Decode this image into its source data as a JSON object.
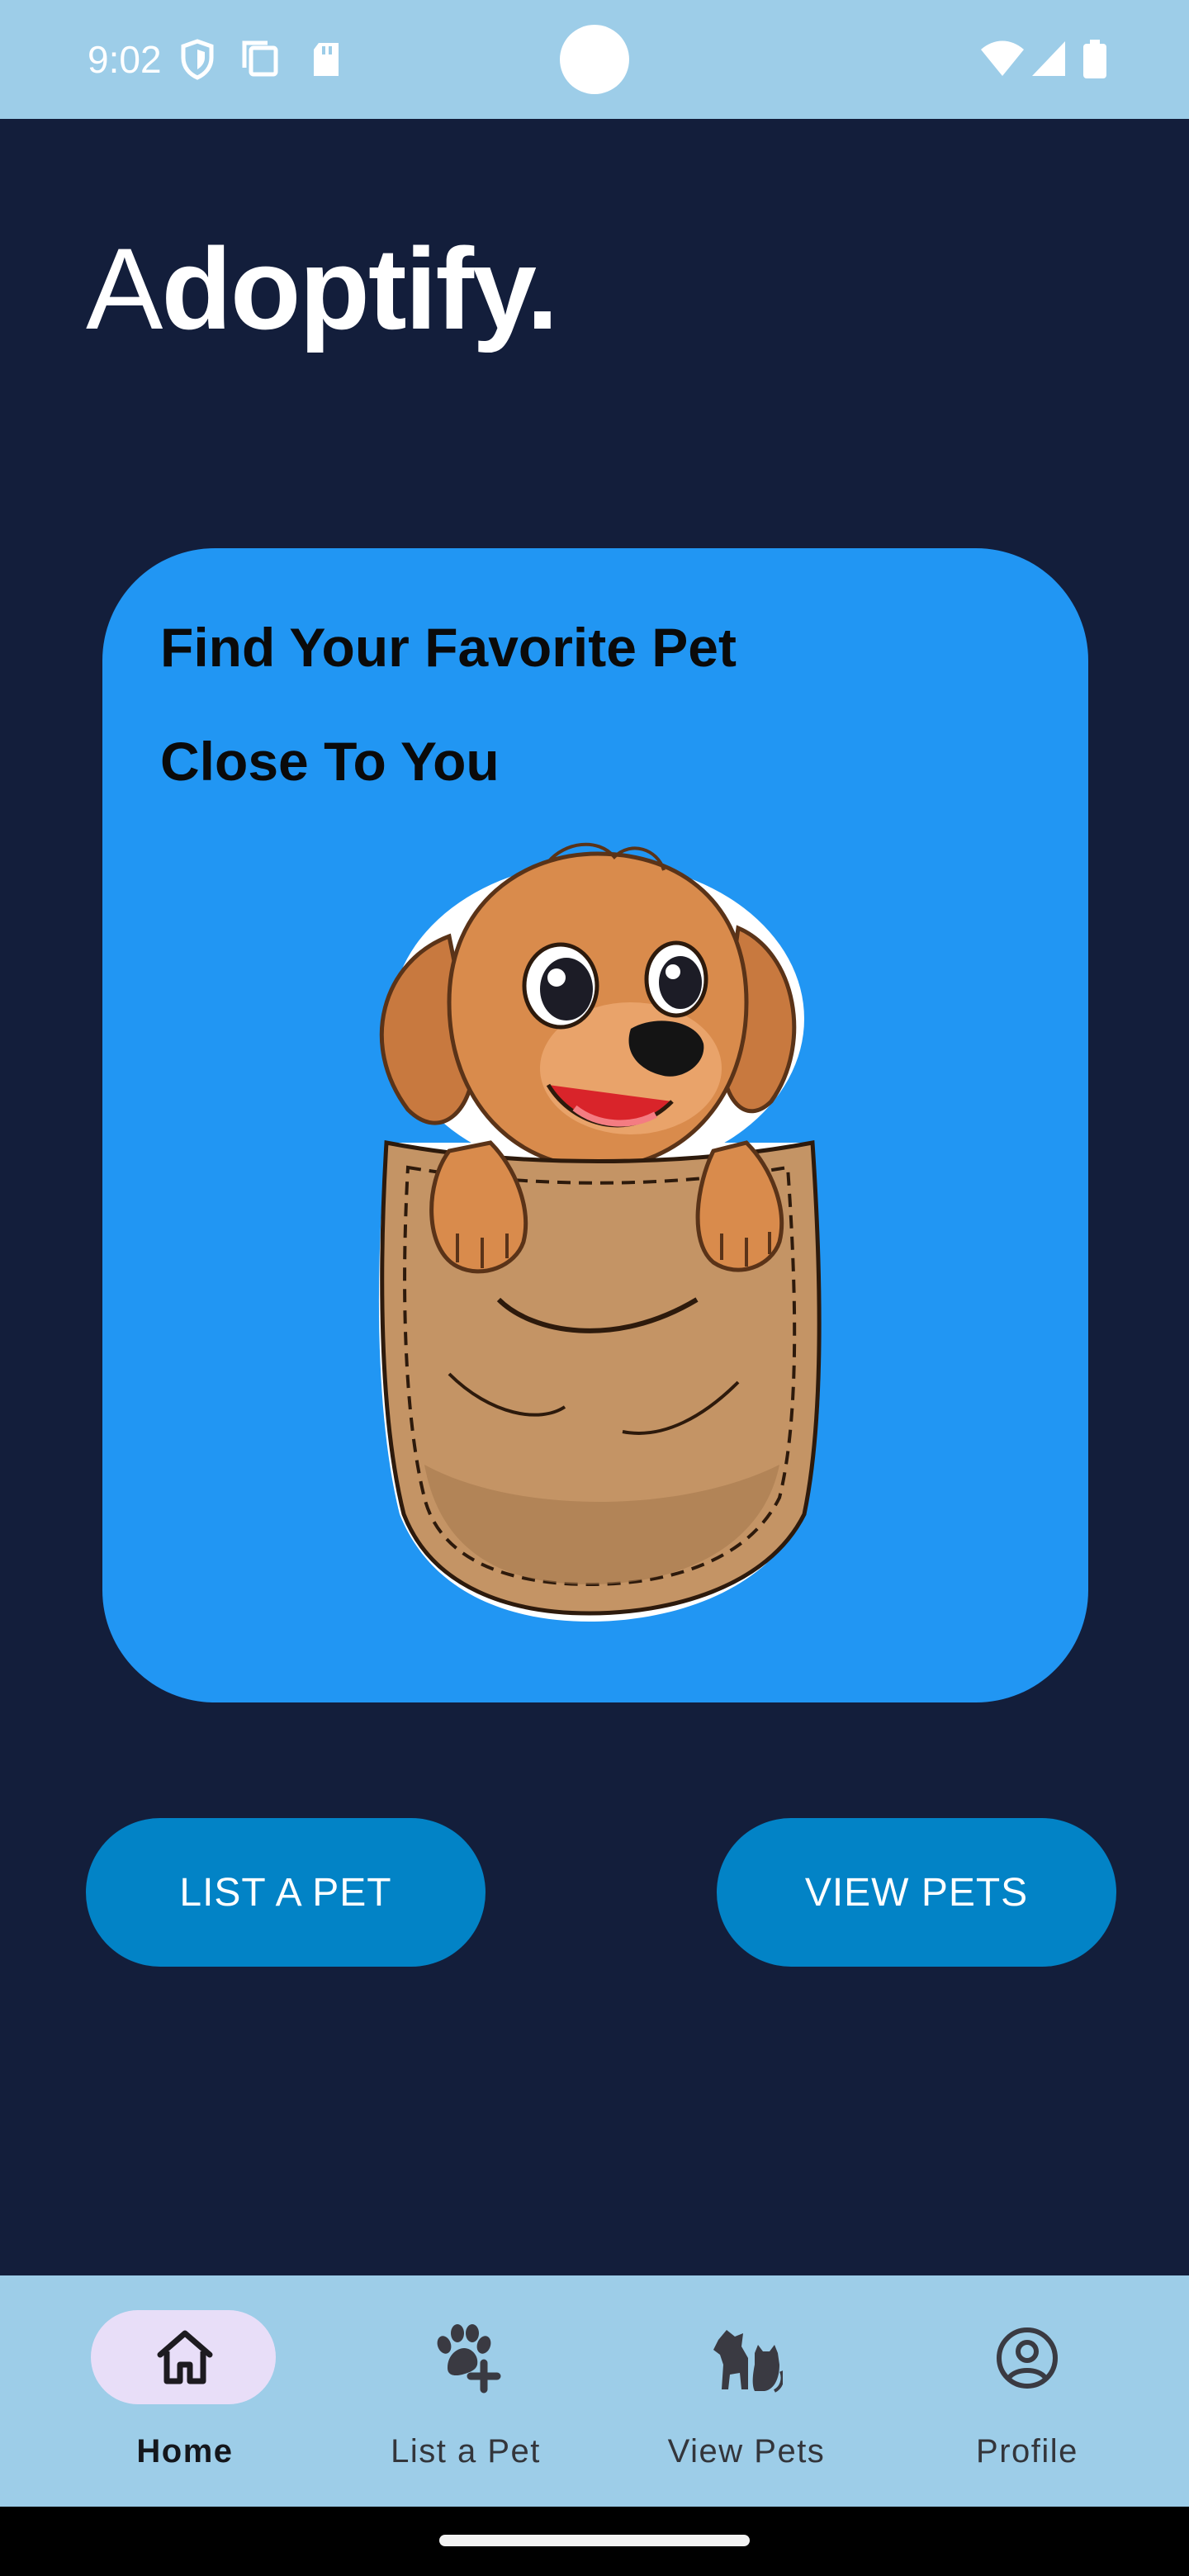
{
  "status_bar": {
    "time": "9:02",
    "left_icons": [
      "shield-icon",
      "copy-icon",
      "sd-card-icon"
    ],
    "right_icons": [
      "wifi-icon",
      "cell-signal-icon",
      "battery-icon"
    ]
  },
  "app": {
    "title_light": "A",
    "title_bold": "doptify."
  },
  "hero": {
    "line1": "Find Your Favorite Pet",
    "line2": "Close To You",
    "illustration": "puppy-in-pocket"
  },
  "actions": {
    "list_pet": "LIST A PET",
    "view_pets": "VIEW PETS"
  },
  "nav": {
    "items": [
      {
        "label": "Home",
        "icon": "home-icon",
        "active": true
      },
      {
        "label": "List a Pet",
        "icon": "paw-plus-icon",
        "active": false
      },
      {
        "label": "View Pets",
        "icon": "dog-cat-icon",
        "active": false
      },
      {
        "label": "Profile",
        "icon": "account-circle-icon",
        "active": false
      }
    ]
  },
  "colors": {
    "background": "#131e3b",
    "status_bar": "#9dcde8",
    "hero_card": "#2196f3",
    "button": "#0283c6",
    "nav_active_pill": "#e8def8"
  }
}
